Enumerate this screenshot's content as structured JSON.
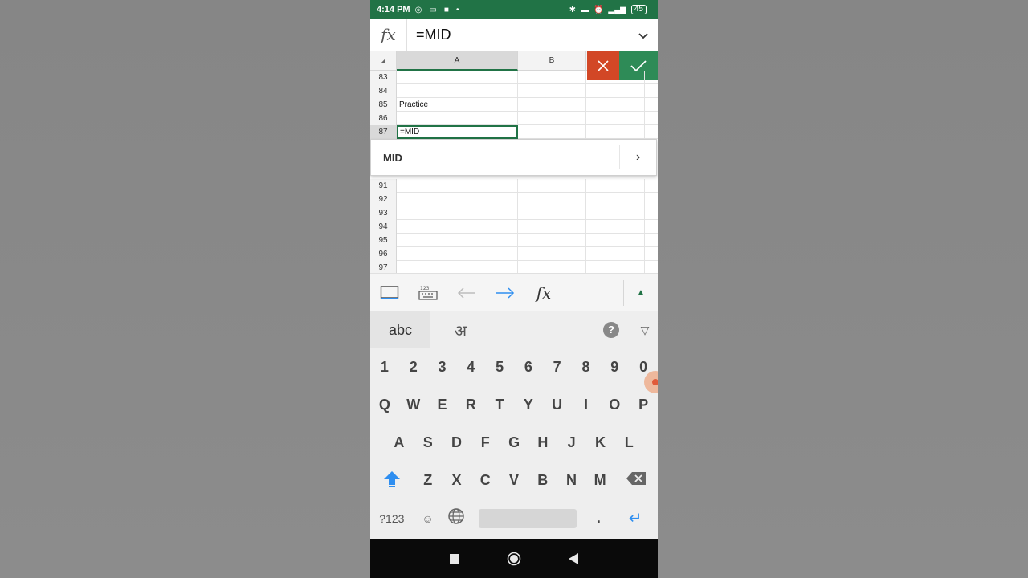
{
  "status_bar": {
    "time": "4:14 PM",
    "battery": "45",
    "icons": [
      "whatsapp-icon",
      "gallery-icon",
      "video-icon",
      "bluetooth-icon",
      "alarm-icon",
      "signal-icon"
    ]
  },
  "formula_bar": {
    "fx_label": "fx",
    "formula": "=MID"
  },
  "grid": {
    "columns": [
      "A",
      "B"
    ],
    "rows": [
      {
        "num": "83",
        "a": ""
      },
      {
        "num": "84",
        "a": ""
      },
      {
        "num": "85",
        "a": "Practice"
      },
      {
        "num": "86",
        "a": ""
      },
      {
        "num": "87",
        "a": "=MID"
      },
      {
        "num": "91",
        "a": ""
      },
      {
        "num": "92",
        "a": ""
      },
      {
        "num": "93",
        "a": ""
      },
      {
        "num": "94",
        "a": ""
      },
      {
        "num": "95",
        "a": ""
      },
      {
        "num": "96",
        "a": ""
      },
      {
        "num": "97",
        "a": ""
      }
    ],
    "active_row": "87"
  },
  "autocomplete": {
    "function_name": "MID"
  },
  "toolbar": {
    "items": [
      "select-cell-icon",
      "numeric-keyboard-icon",
      "back-arrow-icon",
      "forward-arrow-icon",
      "fx-icon"
    ],
    "fx_label": "fx",
    "numeric_label": "123"
  },
  "keyboard": {
    "lang_primary": "abc",
    "lang_secondary": "अ",
    "help": "?",
    "digits": [
      "1",
      "2",
      "3",
      "4",
      "5",
      "6",
      "7",
      "8",
      "9",
      "0"
    ],
    "row1": [
      "Q",
      "W",
      "E",
      "R",
      "T",
      "Y",
      "U",
      "I",
      "O",
      "P"
    ],
    "row2": [
      "A",
      "S",
      "D",
      "F",
      "G",
      "H",
      "J",
      "K",
      "L"
    ],
    "row3": [
      "Z",
      "X",
      "C",
      "V",
      "B",
      "N",
      "M"
    ],
    "symbols_label": "?123",
    "period": "."
  },
  "colors": {
    "excel_green": "#217346",
    "cancel_red": "#d24726",
    "confirm_green": "#2e8b57",
    "accent_blue": "#2e8ef0"
  }
}
